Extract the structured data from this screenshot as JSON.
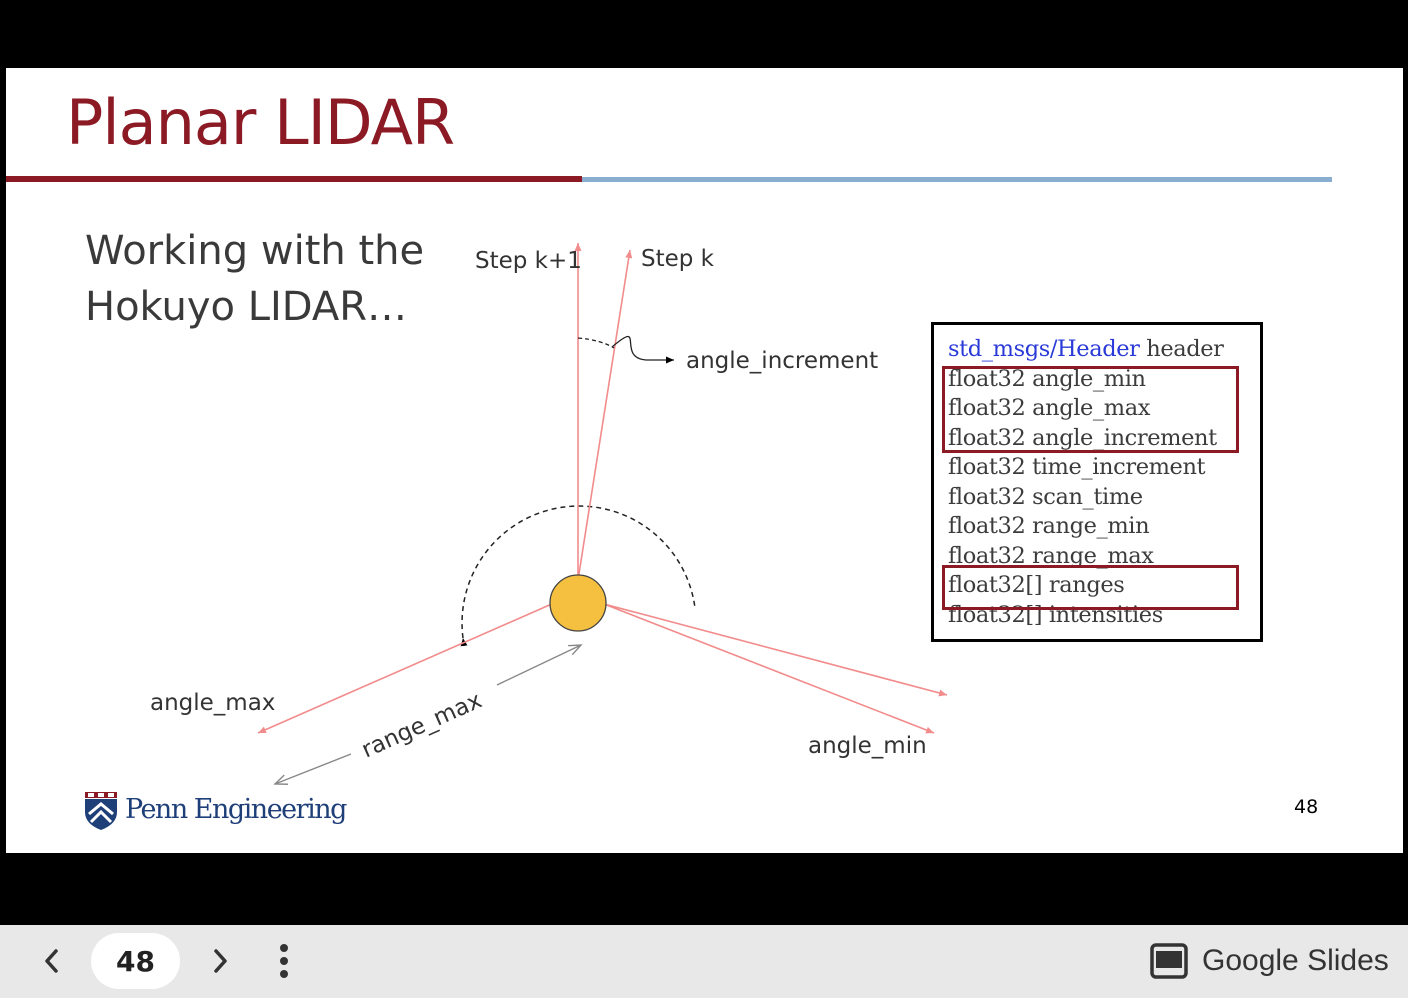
{
  "slide": {
    "title": "Planar LIDAR",
    "subtitle_line1": "Working with the",
    "subtitle_line2": "Hokuyo LIDAR…",
    "page_number": "48",
    "logo_text": "Penn Engineering"
  },
  "diagram": {
    "step_k1": "Step k+1",
    "step_k": "Step k",
    "angle_increment": "angle_increment",
    "angle_max": "angle_max",
    "range_max": "range_max",
    "angle_min": "angle_min"
  },
  "message": {
    "header_type": "std_msgs/Header",
    "header_name": " header",
    "fields": [
      "float32 angle_min",
      "float32 angle_max",
      "float32 angle_increment",
      "float32 time_increment",
      "float32 scan_time",
      "float32 range_min",
      "float32 range_max",
      "float32[] ranges",
      "float32[] intensities"
    ]
  },
  "colors": {
    "title": "#8b1a24",
    "rule_blue": "#8aaed0",
    "ray": "#f28b8b",
    "sensor": "#f5c040",
    "header_blue": "#2a3ad8"
  },
  "controls": {
    "current_page": "48",
    "brand": "Google Slides",
    "prev_icon": "chevron-left-icon",
    "next_icon": "chevron-right-icon",
    "menu_icon": "more-vert-icon",
    "brand_icon": "slides-icon"
  }
}
